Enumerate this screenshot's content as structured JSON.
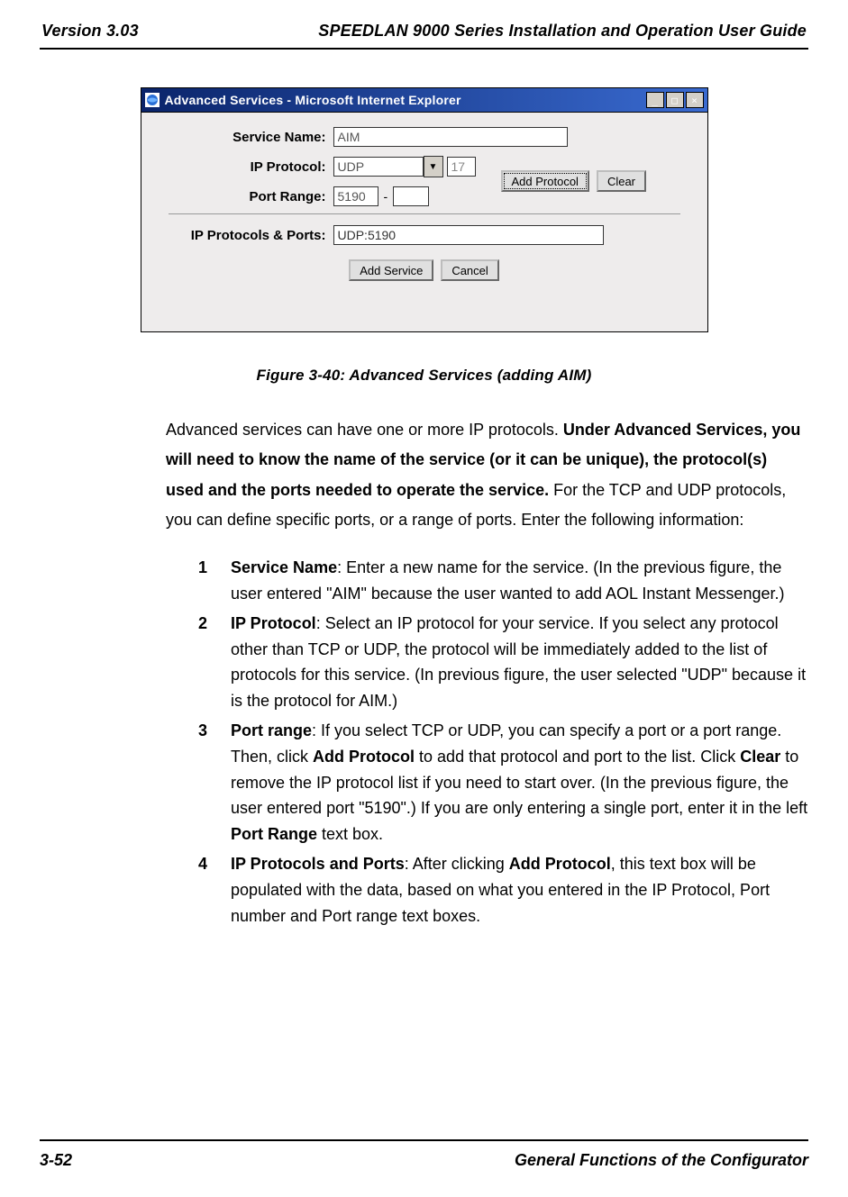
{
  "header": {
    "version": "Version 3.03",
    "title": "SPEEDLAN 9000 Series Installation and Operation User Guide"
  },
  "window": {
    "title": "Advanced Services - Microsoft Internet Explorer",
    "btn_min_glyph": "_",
    "btn_max_glyph": "□",
    "btn_close_glyph": "×",
    "form": {
      "service_name_label": "Service Name:",
      "service_name_value": "AIM",
      "ip_protocol_label": "IP Protocol:",
      "ip_protocol_value": "UDP",
      "dropdown_glyph": "▼",
      "protocol_number_value": "17",
      "port_range_label": "Port Range:",
      "port_range_low": "5190",
      "port_range_sep": "-",
      "port_range_high": "",
      "btn_add_protocol": "Add Protocol",
      "btn_clear": "Clear",
      "ip_protocols_ports_label": "IP Protocols & Ports:",
      "ip_protocols_ports_value": "UDP:5190",
      "btn_add_service": "Add Service",
      "btn_cancel": "Cancel"
    }
  },
  "caption": "Figure 3-40: Advanced Services (adding AIM)",
  "paragraph": {
    "p1_a": "Advanced services can have one or more IP protocols. ",
    "p1_b": "Under Advanced Services, you will need to know the name of the service (or it can be unique), the protocol(s) used and the ports needed to operate the service.",
    "p1_c": " For the TCP and UDP protocols, you can define specific ports, or a range of ports. Enter the following information:"
  },
  "list": {
    "n1": "1",
    "n2": "2",
    "n3": "3",
    "n4": "4",
    "i1_b": "Service Name",
    "i1_t": ": Enter a new name for the service. (In the previous figure, the user entered \"AIM\" because the user wanted to add AOL Instant Messenger.)",
    "i2_b": "IP Protocol",
    "i2_t": ": Select an IP protocol for your service. If you select any protocol other than TCP or UDP, the protocol will be immediately added to the list of protocols for this service. (In previous figure, the user selected \"UDP\" because it is the protocol for AIM.)",
    "i3_b": "Port range",
    "i3_t1": ":  If you select TCP or UDP, you can specify a port or a port range. Then, click ",
    "i3_b2": "Add Protocol",
    "i3_t2": " to add that protocol and port to the list. Click ",
    "i3_b3": "Clear",
    "i3_t3": " to remove the IP protocol list if you need to start over. (In the previous figure, the user entered port \"5190\".)  If you are only entering a single port, enter it in the left ",
    "i3_b4": "Port Range",
    "i3_t4": " text box.",
    "i4_b": "IP Protocols and Ports",
    "i4_t1": ": After clicking ",
    "i4_b2": "Add Protocol",
    "i4_t2": ", this text box will be populated with the data, based on what you entered in the IP Protocol, Port number and Port range text boxes."
  },
  "footer": {
    "page": "3-52",
    "section": "General Functions of the Configurator"
  }
}
